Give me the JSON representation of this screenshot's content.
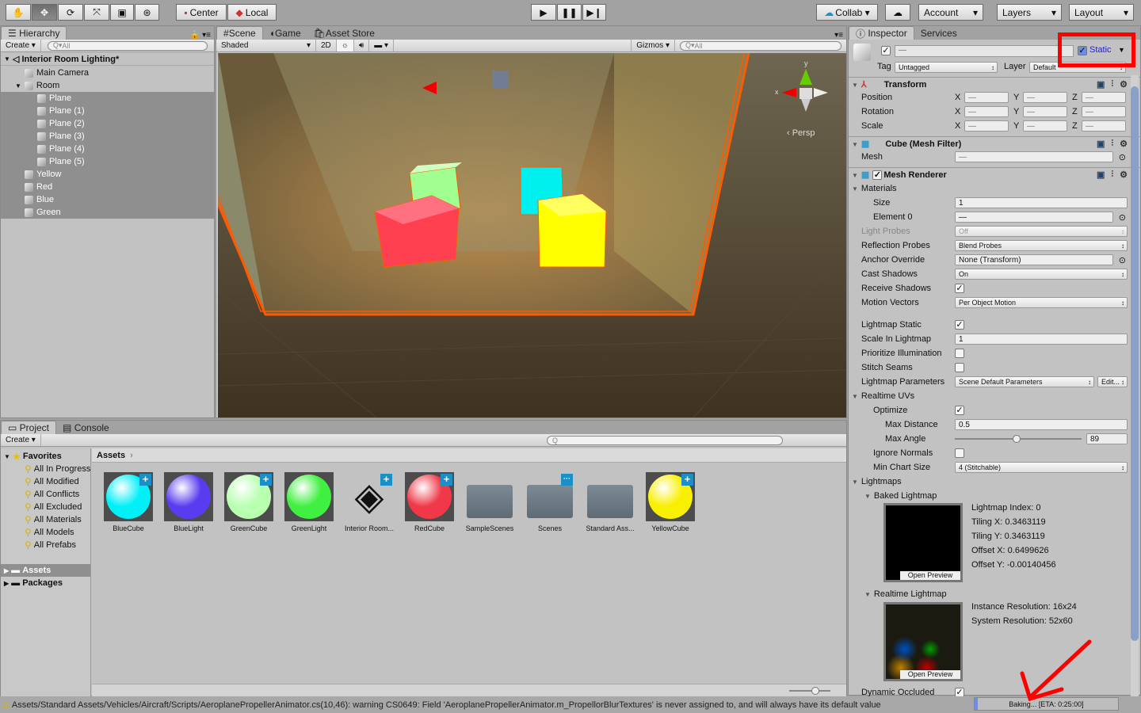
{
  "toolbar": {
    "tools": [
      "hand-tool",
      "move-tool",
      "rotate-tool",
      "scale-tool",
      "rect-tool",
      "transform-tool"
    ],
    "pivot": "Center",
    "space": "Local",
    "collab": "Collab",
    "account": "Account",
    "layers": "Layers",
    "layout": "Layout"
  },
  "hierarchy": {
    "tab": "Hierarchy",
    "create": "Create",
    "search_placeholder": "All",
    "scene": "Interior Room Lighting*",
    "items": [
      {
        "label": "Main Camera",
        "depth": 1,
        "selected": false
      },
      {
        "label": "Room",
        "depth": 1,
        "selected": false,
        "expanded": true
      },
      {
        "label": "Plane",
        "depth": 2,
        "selected": true
      },
      {
        "label": "Plane (1)",
        "depth": 2,
        "selected": true
      },
      {
        "label": "Plane (2)",
        "depth": 2,
        "selected": true
      },
      {
        "label": "Plane (3)",
        "depth": 2,
        "selected": true
      },
      {
        "label": "Plane (4)",
        "depth": 2,
        "selected": true
      },
      {
        "label": "Plane (5)",
        "depth": 2,
        "selected": true
      },
      {
        "label": "Yellow",
        "depth": 1,
        "selected": true
      },
      {
        "label": "Red",
        "depth": 1,
        "selected": true
      },
      {
        "label": "Blue",
        "depth": 1,
        "selected": true
      },
      {
        "label": "Green",
        "depth": 1,
        "selected": true
      }
    ]
  },
  "scene": {
    "tabs": [
      "Scene",
      "Game",
      "Asset Store"
    ],
    "shading": "Shaded",
    "mode_2d": "2D",
    "gizmos": "Gizmos",
    "search_placeholder": "All",
    "projection": "Persp",
    "gizmo_axes": [
      "y",
      "x"
    ],
    "selection_color": "#ff5a00"
  },
  "inspector": {
    "tabs": [
      "Inspector",
      "Services"
    ],
    "name_value": "—",
    "static_label": "Static",
    "static_checked": true,
    "tag_label": "Tag",
    "tag_value": "Untagged",
    "layer_label": "Layer",
    "layer_value": "Default",
    "transform": {
      "title": "Transform",
      "rows": [
        {
          "label": "Position",
          "x": "—",
          "y": "—",
          "z": "—"
        },
        {
          "label": "Rotation",
          "x": "—",
          "y": "—",
          "z": "—"
        },
        {
          "label": "Scale",
          "x": "—",
          "y": "—",
          "z": "—"
        }
      ],
      "axes": [
        "X",
        "Y",
        "Z"
      ]
    },
    "mesh_filter": {
      "title": "Cube (Mesh Filter)",
      "mesh_label": "Mesh",
      "mesh_value": "—"
    },
    "mesh_renderer": {
      "title": "Mesh Renderer",
      "rows": [
        {
          "type": "fold",
          "label": "Materials",
          "indent": 0
        },
        {
          "type": "field",
          "label": "Size",
          "value": "1",
          "indent": 1
        },
        {
          "type": "object",
          "label": "Element 0",
          "value": "—",
          "indent": 1
        },
        {
          "type": "popup",
          "label": "Light Probes",
          "value": "Off",
          "indent": 0,
          "disabled": true
        },
        {
          "type": "popup",
          "label": "Reflection Probes",
          "value": "Blend Probes",
          "indent": 0
        },
        {
          "type": "object",
          "label": "Anchor Override",
          "value": "None (Transform)",
          "indent": 0
        },
        {
          "type": "popup",
          "label": "Cast Shadows",
          "value": "On",
          "indent": 0
        },
        {
          "type": "check",
          "label": "Receive Shadows",
          "checked": true,
          "indent": 0
        },
        {
          "type": "popup",
          "label": "Motion Vectors",
          "value": "Per Object Motion",
          "indent": 0
        },
        {
          "type": "gap"
        },
        {
          "type": "check",
          "label": "Lightmap Static",
          "checked": true,
          "indent": 0
        },
        {
          "type": "field",
          "label": "Scale In Lightmap",
          "value": "1",
          "indent": 0
        },
        {
          "type": "check",
          "label": "Prioritize Illumination",
          "checked": false,
          "indent": 0
        },
        {
          "type": "check",
          "label": "Stitch Seams",
          "checked": false,
          "indent": 0
        },
        {
          "type": "popup-edit",
          "label": "Lightmap Parameters",
          "value": "Scene Default Parameters",
          "button": "Edit...",
          "indent": 0
        },
        {
          "type": "fold",
          "label": "Realtime UVs",
          "indent": 0
        },
        {
          "type": "check",
          "label": "Optimize",
          "checked": true,
          "indent": 1
        },
        {
          "type": "field",
          "label": "Max Distance",
          "value": "0.5",
          "indent": 2
        },
        {
          "type": "slider",
          "label": "Max Angle",
          "value": "89",
          "fraction": 0.49,
          "indent": 2
        },
        {
          "type": "check",
          "label": "Ignore Normals",
          "checked": false,
          "indent": 1
        },
        {
          "type": "popup",
          "label": "Min Chart Size",
          "value": "4 (Stitchable)",
          "indent": 1
        },
        {
          "type": "fold",
          "label": "Lightmaps",
          "indent": 0
        },
        {
          "type": "fold",
          "label": "Baked Lightmap",
          "indent": 1
        }
      ]
    },
    "baked": {
      "open_preview": "Open Preview",
      "info": [
        "Lightmap Index: 0",
        "Tiling X: 0.3463119",
        "Tiling Y: 0.3463119",
        "Offset X: 0.6499626",
        "Offset Y: -0.00140456"
      ]
    },
    "realtime": {
      "title": "Realtime Lightmap",
      "open_preview": "Open Preview",
      "info": [
        "Instance Resolution: 16x24",
        "System Resolution: 52x60"
      ]
    },
    "dynamic_occluded": {
      "label": "Dynamic Occluded",
      "checked": true
    }
  },
  "project": {
    "tabs": [
      "Project",
      "Console"
    ],
    "create": "Create",
    "favorites_label": "Favorites",
    "favorites": [
      "All In Progress",
      "All Modified",
      "All Conflicts",
      "All Excluded",
      "All Materials",
      "All Models",
      "All Prefabs"
    ],
    "roots": [
      "Assets",
      "Packages"
    ],
    "breadcrumb": "Assets",
    "assets": [
      {
        "name": "BlueCube",
        "kind": "ball",
        "color": "#00f0f8",
        "plus": true
      },
      {
        "name": "BlueLight",
        "kind": "ball",
        "color": "#5a3cf0",
        "plus": false
      },
      {
        "name": "GreenCube",
        "kind": "ball",
        "color": "#b8ffb0",
        "plus": true
      },
      {
        "name": "GreenLight",
        "kind": "ball",
        "color": "#40f040",
        "plus": false
      },
      {
        "name": "Interior Room...",
        "kind": "unity",
        "plus": true
      },
      {
        "name": "RedCube",
        "kind": "ball",
        "color": "#f03848",
        "plus": true
      },
      {
        "name": "SampleScenes",
        "kind": "folder",
        "plus": false
      },
      {
        "name": "Scenes",
        "kind": "folder",
        "dots": true
      },
      {
        "name": "Standard Ass...",
        "kind": "folder",
        "plus": false
      },
      {
        "name": "YellowCube",
        "kind": "ball",
        "color": "#f8f000",
        "plus": true
      }
    ]
  },
  "status": {
    "message": "Assets/Standard Assets/Vehicles/Aircraft/Scripts/AeroplanePropellerAnimator.cs(10,46): warning CS0649: Field 'AeroplanePropellerAnimator.m_PropellorBlurTextures' is never assigned to, and will always have its default value",
    "baking": "Baking... [ETA: 0:25:00]",
    "bake_progress": 0.02
  },
  "annotation_color": "#ff0000"
}
